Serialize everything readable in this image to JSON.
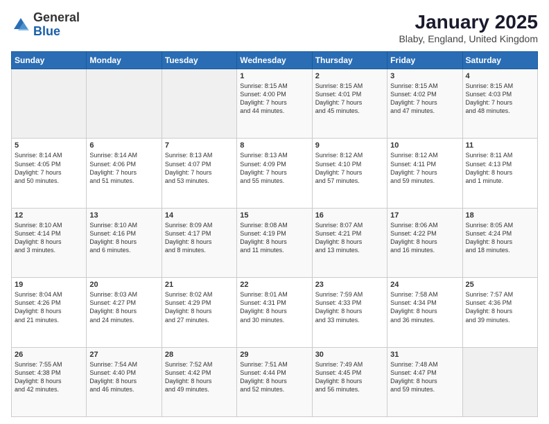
{
  "logo": {
    "general": "General",
    "blue": "Blue"
  },
  "header": {
    "title": "January 2025",
    "location": "Blaby, England, United Kingdom"
  },
  "weekdays": [
    "Sunday",
    "Monday",
    "Tuesday",
    "Wednesday",
    "Thursday",
    "Friday",
    "Saturday"
  ],
  "weeks": [
    [
      {
        "day": "",
        "content": ""
      },
      {
        "day": "",
        "content": ""
      },
      {
        "day": "",
        "content": ""
      },
      {
        "day": "1",
        "content": "Sunrise: 8:15 AM\nSunset: 4:00 PM\nDaylight: 7 hours\nand 44 minutes."
      },
      {
        "day": "2",
        "content": "Sunrise: 8:15 AM\nSunset: 4:01 PM\nDaylight: 7 hours\nand 45 minutes."
      },
      {
        "day": "3",
        "content": "Sunrise: 8:15 AM\nSunset: 4:02 PM\nDaylight: 7 hours\nand 47 minutes."
      },
      {
        "day": "4",
        "content": "Sunrise: 8:15 AM\nSunset: 4:03 PM\nDaylight: 7 hours\nand 48 minutes."
      }
    ],
    [
      {
        "day": "5",
        "content": "Sunrise: 8:14 AM\nSunset: 4:05 PM\nDaylight: 7 hours\nand 50 minutes."
      },
      {
        "day": "6",
        "content": "Sunrise: 8:14 AM\nSunset: 4:06 PM\nDaylight: 7 hours\nand 51 minutes."
      },
      {
        "day": "7",
        "content": "Sunrise: 8:13 AM\nSunset: 4:07 PM\nDaylight: 7 hours\nand 53 minutes."
      },
      {
        "day": "8",
        "content": "Sunrise: 8:13 AM\nSunset: 4:09 PM\nDaylight: 7 hours\nand 55 minutes."
      },
      {
        "day": "9",
        "content": "Sunrise: 8:12 AM\nSunset: 4:10 PM\nDaylight: 7 hours\nand 57 minutes."
      },
      {
        "day": "10",
        "content": "Sunrise: 8:12 AM\nSunset: 4:11 PM\nDaylight: 7 hours\nand 59 minutes."
      },
      {
        "day": "11",
        "content": "Sunrise: 8:11 AM\nSunset: 4:13 PM\nDaylight: 8 hours\nand 1 minute."
      }
    ],
    [
      {
        "day": "12",
        "content": "Sunrise: 8:10 AM\nSunset: 4:14 PM\nDaylight: 8 hours\nand 3 minutes."
      },
      {
        "day": "13",
        "content": "Sunrise: 8:10 AM\nSunset: 4:16 PM\nDaylight: 8 hours\nand 6 minutes."
      },
      {
        "day": "14",
        "content": "Sunrise: 8:09 AM\nSunset: 4:17 PM\nDaylight: 8 hours\nand 8 minutes."
      },
      {
        "day": "15",
        "content": "Sunrise: 8:08 AM\nSunset: 4:19 PM\nDaylight: 8 hours\nand 11 minutes."
      },
      {
        "day": "16",
        "content": "Sunrise: 8:07 AM\nSunset: 4:21 PM\nDaylight: 8 hours\nand 13 minutes."
      },
      {
        "day": "17",
        "content": "Sunrise: 8:06 AM\nSunset: 4:22 PM\nDaylight: 8 hours\nand 16 minutes."
      },
      {
        "day": "18",
        "content": "Sunrise: 8:05 AM\nSunset: 4:24 PM\nDaylight: 8 hours\nand 18 minutes."
      }
    ],
    [
      {
        "day": "19",
        "content": "Sunrise: 8:04 AM\nSunset: 4:26 PM\nDaylight: 8 hours\nand 21 minutes."
      },
      {
        "day": "20",
        "content": "Sunrise: 8:03 AM\nSunset: 4:27 PM\nDaylight: 8 hours\nand 24 minutes."
      },
      {
        "day": "21",
        "content": "Sunrise: 8:02 AM\nSunset: 4:29 PM\nDaylight: 8 hours\nand 27 minutes."
      },
      {
        "day": "22",
        "content": "Sunrise: 8:01 AM\nSunset: 4:31 PM\nDaylight: 8 hours\nand 30 minutes."
      },
      {
        "day": "23",
        "content": "Sunrise: 7:59 AM\nSunset: 4:33 PM\nDaylight: 8 hours\nand 33 minutes."
      },
      {
        "day": "24",
        "content": "Sunrise: 7:58 AM\nSunset: 4:34 PM\nDaylight: 8 hours\nand 36 minutes."
      },
      {
        "day": "25",
        "content": "Sunrise: 7:57 AM\nSunset: 4:36 PM\nDaylight: 8 hours\nand 39 minutes."
      }
    ],
    [
      {
        "day": "26",
        "content": "Sunrise: 7:55 AM\nSunset: 4:38 PM\nDaylight: 8 hours\nand 42 minutes."
      },
      {
        "day": "27",
        "content": "Sunrise: 7:54 AM\nSunset: 4:40 PM\nDaylight: 8 hours\nand 46 minutes."
      },
      {
        "day": "28",
        "content": "Sunrise: 7:52 AM\nSunset: 4:42 PM\nDaylight: 8 hours\nand 49 minutes."
      },
      {
        "day": "29",
        "content": "Sunrise: 7:51 AM\nSunset: 4:44 PM\nDaylight: 8 hours\nand 52 minutes."
      },
      {
        "day": "30",
        "content": "Sunrise: 7:49 AM\nSunset: 4:45 PM\nDaylight: 8 hours\nand 56 minutes."
      },
      {
        "day": "31",
        "content": "Sunrise: 7:48 AM\nSunset: 4:47 PM\nDaylight: 8 hours\nand 59 minutes."
      },
      {
        "day": "",
        "content": ""
      }
    ]
  ]
}
